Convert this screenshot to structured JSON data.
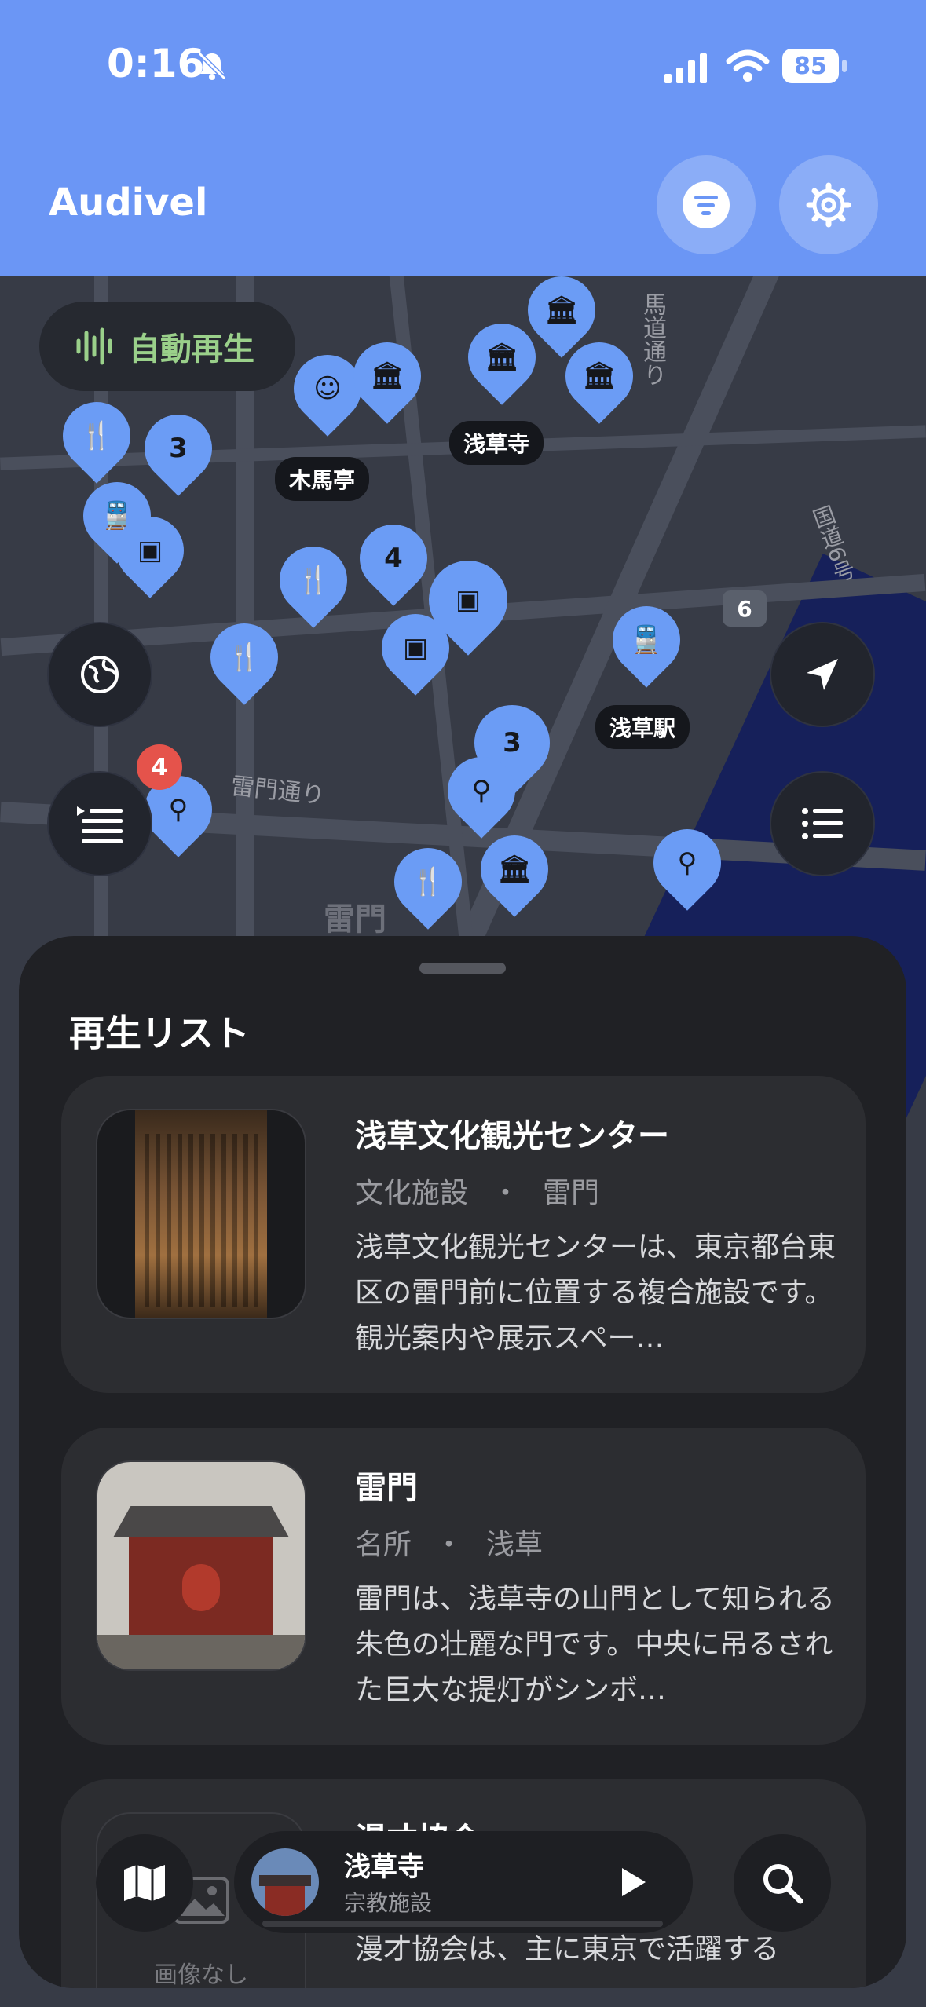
{
  "status": {
    "time": "0:16",
    "battery": "85"
  },
  "header": {
    "title": "Audivel"
  },
  "map": {
    "autoplay_label": "自動再生",
    "playlist_badge": "4",
    "labels": [
      "浅草寺",
      "木馬亭",
      "浅草駅",
      "雷門通り",
      "雷門",
      "馬道通り",
      "国道6号",
      "6"
    ],
    "cluster_counts": [
      "3",
      "4",
      "3"
    ]
  },
  "sheet": {
    "title": "再生リスト",
    "items": [
      {
        "title": "浅草文化観光センター",
        "category": "文化施設",
        "area": "雷門",
        "sep": "・",
        "description": "浅草文化観光センターは、東京都台東区の雷門前に位置する複合施設です。観光案内や展示スペー…"
      },
      {
        "title": "雷門",
        "category": "名所",
        "area": "浅草",
        "sep": "・",
        "description": "雷門は、浅草寺の山門として知られる朱色の壮麗な門です。中央に吊るされた巨大な提灯がシンボ…"
      },
      {
        "title": "漫才協会",
        "no_image": "画像なし",
        "description": "漫才協会は、主に東京で活躍する"
      }
    ]
  },
  "now_playing": {
    "title": "浅草寺",
    "subtitle": "宗教施設"
  },
  "colors": {
    "header": "#6b96f5",
    "pin": "#6b9cf5",
    "badge": "#e5534b"
  }
}
